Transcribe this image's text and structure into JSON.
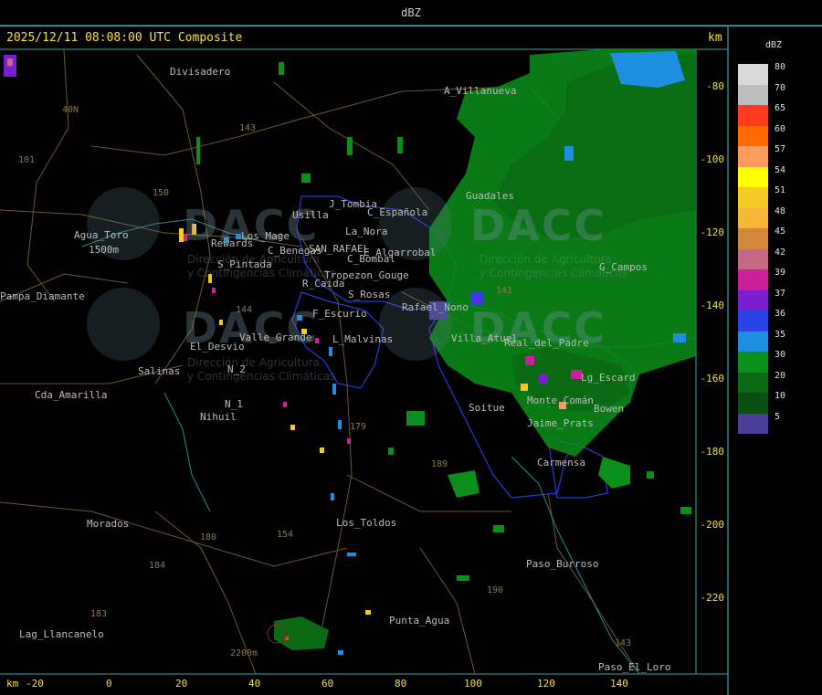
{
  "title": "dBZ",
  "header": {
    "timestamp": "2025/12/11 08:08:00 UTC Composite",
    "km_top": "km",
    "km_bottom": "km"
  },
  "axes": {
    "y_ticks": [
      "-80",
      "-100",
      "-120",
      "-140",
      "-160",
      "-180",
      "-200",
      "-220"
    ],
    "x_ticks": [
      "-20",
      "0",
      "20",
      "40",
      "60",
      "80",
      "100",
      "120",
      "140"
    ]
  },
  "legend": {
    "title": "dBZ",
    "entries": [
      {
        "value": "80",
        "color": "#d8d8d8"
      },
      {
        "value": "70",
        "color": "#bdbdbd"
      },
      {
        "value": "65",
        "color": "#ff3b1f"
      },
      {
        "value": "60",
        "color": "#ff6a00"
      },
      {
        "value": "57",
        "color": "#ff9a5a"
      },
      {
        "value": "54",
        "color": "#ffff00"
      },
      {
        "value": "51",
        "color": "#f5c823"
      },
      {
        "value": "48",
        "color": "#f5b735"
      },
      {
        "value": "45",
        "color": "#d2873a"
      },
      {
        "value": "42",
        "color": "#c46a86"
      },
      {
        "value": "39",
        "color": "#cc1f9a"
      },
      {
        "value": "37",
        "color": "#7a1fd0"
      },
      {
        "value": "36",
        "color": "#2a44e8"
      },
      {
        "value": "35",
        "color": "#1e8ee0"
      },
      {
        "value": "30",
        "color": "#0a8f1a"
      },
      {
        "value": "20",
        "color": "#0a6b14"
      },
      {
        "value": "10",
        "color": "#0b4f12"
      },
      {
        "value": "5",
        "color": "#4a3e98"
      }
    ]
  },
  "places": [
    "Divisadero",
    "A_Villanueva",
    "Guadales",
    "C_Española",
    "La_Nora",
    "Usilla",
    "J_Tombia",
    "SAN_RAFAEL",
    "C_Benegas",
    "C_Bombal",
    "E_Algarrobal",
    "Rewards",
    "Los_Mage",
    "S_Pintada",
    "Tropezon_Gouge",
    "R_Caida",
    "S_Rosas",
    "Rafael_Nono",
    "F_Escurio",
    "Valle_Grande",
    "El_Desvio",
    "L_Malvinas",
    "Salinas",
    "N_2",
    "N_1",
    "Nihuil",
    "Agua_Toro",
    "1500m",
    "Pampa_Diamante",
    "Cda_Amarilla",
    "Morados",
    "Lag_Llancanelo",
    "2200m",
    "Los_Toldos",
    "Punta_Agua",
    "Soitue",
    "Real_del_Padre",
    "Bowen",
    "Monte_Comán",
    "Carmensa",
    "Paso_Burroso",
    "Paso_El_Loro",
    "G_Campos",
    "Villa_Atuel",
    "Jaime_Prats",
    "Lg_Escard",
    "40N",
    "101",
    "143",
    "150",
    "154",
    "144",
    "179",
    "184",
    "180",
    "183",
    "190",
    "189",
    "141",
    "143"
  ],
  "watermark": {
    "brand": "DACC",
    "line1": "Dirección de Agricultura",
    "line2": "y Contingencias Climáticas"
  },
  "colors": {
    "frame": "#3aa6a6",
    "header_text": "#f5e23a",
    "roads": "#6b5a2e",
    "boundary": "#2a3bd8"
  }
}
